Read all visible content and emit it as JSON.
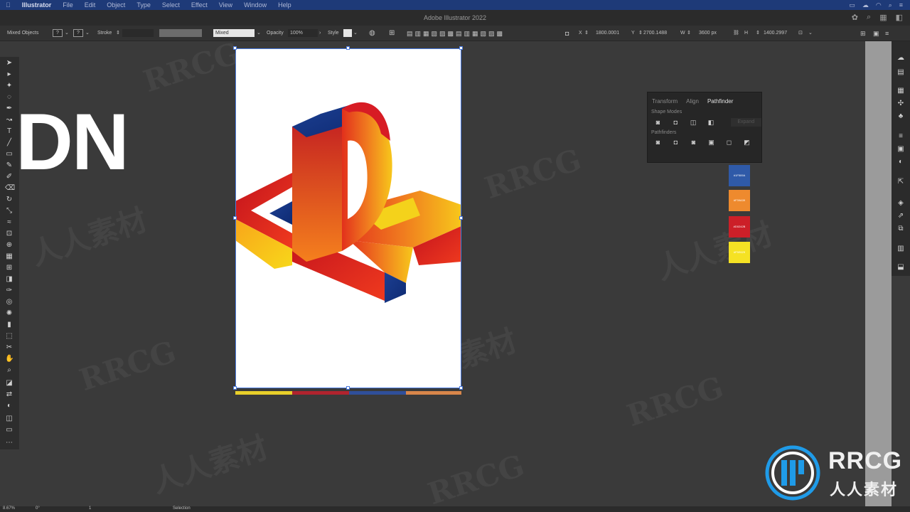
{
  "menubar": {
    "app": "Illustrator",
    "items": [
      "File",
      "Edit",
      "Object",
      "Type",
      "Select",
      "Effect",
      "View",
      "Window",
      "Help"
    ]
  },
  "titlebar": {
    "title": "Adobe Illustrator 2022"
  },
  "controlbar": {
    "selection": "Mixed Objects",
    "stroke_label": "Stroke",
    "blend_mode": "Mixed",
    "opacity_label": "Opacity",
    "opacity_value": "100%",
    "style_label": "Style",
    "x_label": "X",
    "x_value": "1800.0001",
    "y_label": "Y",
    "y_value": "2700.1488",
    "w_label": "W",
    "w_value": "3600 px",
    "h_label": "H",
    "h_value": "1400.2997"
  },
  "canvas": {
    "overlay_text": "DN"
  },
  "pathfinder": {
    "tabs": [
      "Transform",
      "Align",
      "Pathfinder"
    ],
    "shape_modes_label": "Shape Modes",
    "expand_label": "Expand",
    "pathfinders_label": "Pathfinders"
  },
  "swatches": [
    {
      "label": "#1F509A",
      "color": "#2f5aa8"
    },
    {
      "label": "#F39A39",
      "color": "#ee8a2e"
    },
    {
      "label": "#D0242B",
      "color": "#cc1f28"
    },
    {
      "label": "#F5E629",
      "color": "#f5e224"
    }
  ],
  "artboard_strip": [
    "#e8cf2a",
    "#b0232e",
    "#2f4f9a",
    "#d8864a"
  ],
  "statusbar": {
    "zoom": "8.67%",
    "rotate": "0°",
    "artboard": "1",
    "tool": "Selection"
  },
  "watermark": {
    "latin": "RRCG",
    "cjk": "人人素材"
  },
  "logo": {
    "line1": "RRCG",
    "line2": "人人素材"
  }
}
